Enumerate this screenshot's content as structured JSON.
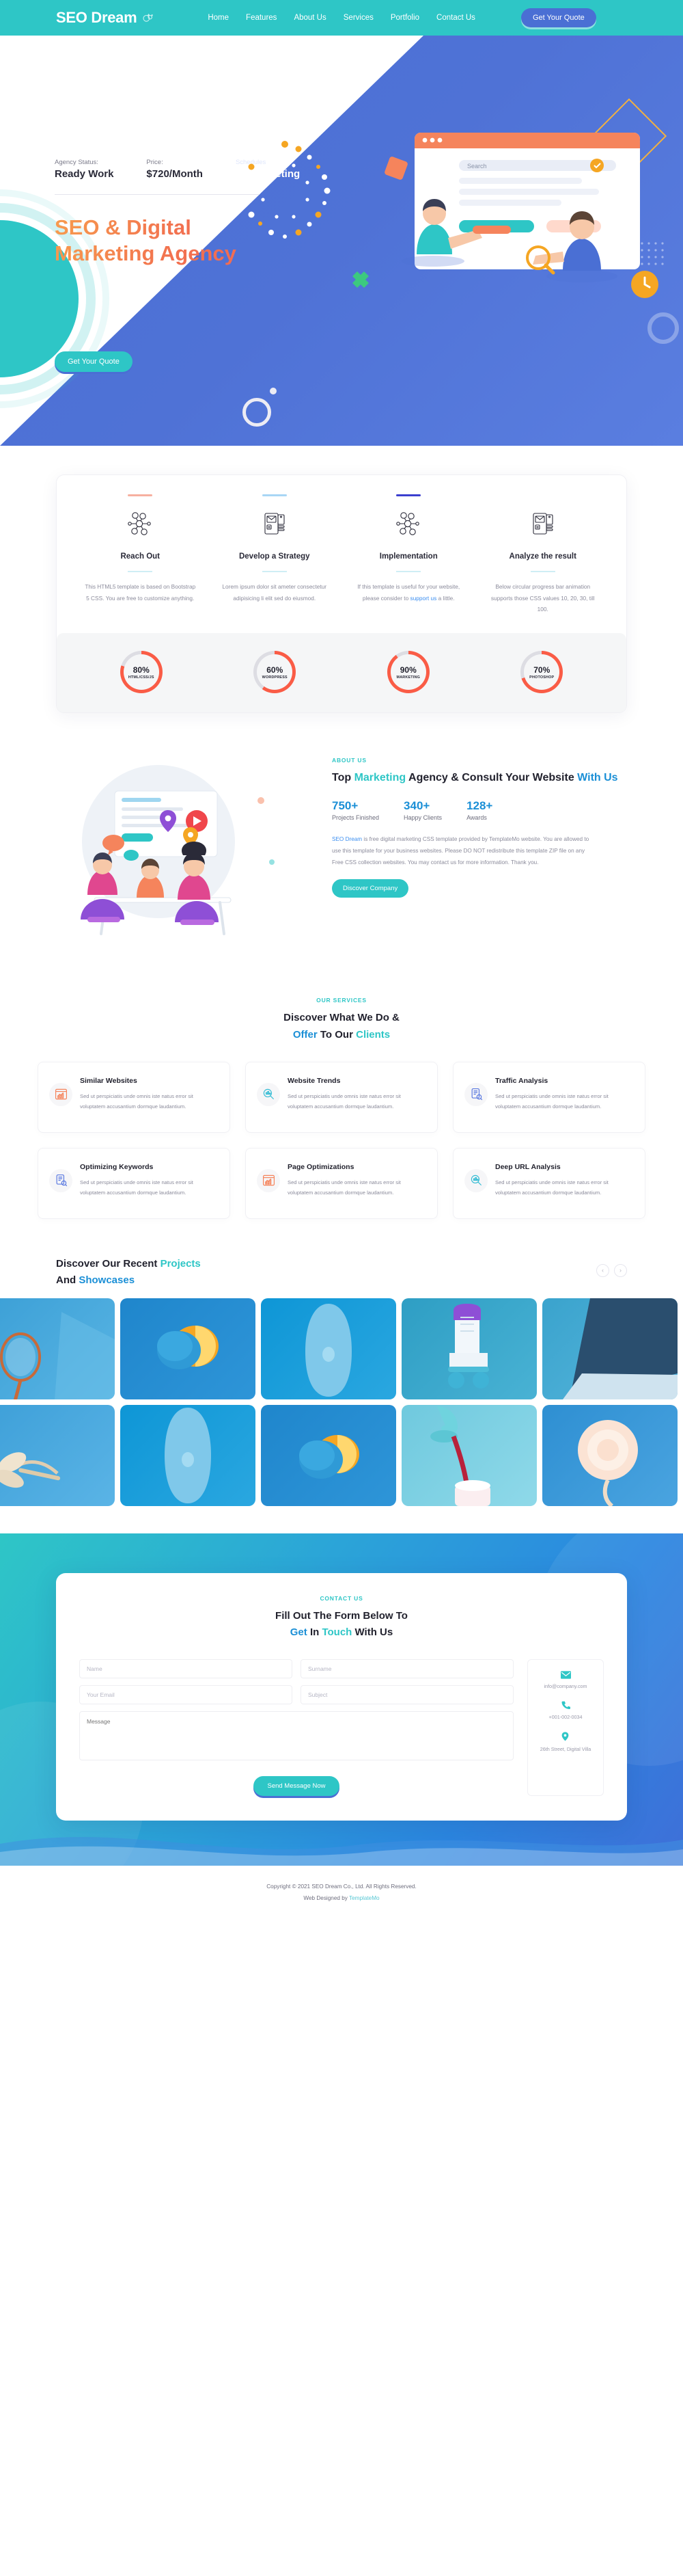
{
  "brand": {
    "name": "SEO Dream",
    "icon": "sparkle-bubbles-icon"
  },
  "nav": {
    "links": [
      {
        "label": "Home"
      },
      {
        "label": "Features"
      },
      {
        "label": "About Us"
      },
      {
        "label": "Services"
      },
      {
        "label": "Portfolio"
      },
      {
        "label": "Contact Us"
      }
    ],
    "cta": "Get Your Quote"
  },
  "hero": {
    "stats": [
      {
        "label": "Agency Status:",
        "value": "Ready Work"
      },
      {
        "label": "Price:",
        "value": "$720/Month"
      },
      {
        "label": "Schedules",
        "value": "$450/Meeting"
      }
    ],
    "title": "SEO & Digital Marketing Agency",
    "cta": "Get Your Quote"
  },
  "process": {
    "items": [
      {
        "top_color": "#f7b0a0",
        "icon": "network-people-icon",
        "title": "Reach Out",
        "text": "This HTML5 template is based on Bootstrap 5 CSS. You are free to customize anything."
      },
      {
        "top_color": "#a8d6f5",
        "icon": "mail-dashboard-icon",
        "title": "Develop a Strategy",
        "text": "Lorem ipsum dolor sit ameter consectetur adipisicing li elit sed do eiusmod."
      },
      {
        "top_color": "#3b3fcf",
        "icon": "network-people-icon",
        "title": "Implementation",
        "text_before": "If this template is useful for your website, please consider to ",
        "link": "support us",
        "text_after": " a little."
      },
      {
        "top_color": "#ffffff",
        "icon": "mail-dashboard-icon",
        "title": "Analyze the result",
        "text": "Below circular progress bar animation supports those CSS values 10, 20, 30, till 100."
      }
    ],
    "skills": [
      {
        "percent": "80%",
        "value": 80,
        "label": "HTML/CSS/JS"
      },
      {
        "percent": "60%",
        "value": 60,
        "label": "WORDPRESS"
      },
      {
        "percent": "90%",
        "value": 90,
        "label": "MARKETING"
      },
      {
        "percent": "70%",
        "value": 70,
        "label": "PHOTOSHOP"
      }
    ],
    "skill_color": "#fa5c46",
    "skill_track": "#dddde3"
  },
  "about": {
    "eyebrow": "ABOUT US",
    "heading_1": "Top ",
    "heading_2": "Marketing",
    "heading_3": " Agency & Consult Your Website ",
    "heading_4": "With Us",
    "counters": [
      {
        "number": "750+",
        "label": "Projects Finished"
      },
      {
        "number": "340+",
        "label": "Happy Clients"
      },
      {
        "number": "128+",
        "label": "Awards"
      }
    ],
    "link_text": "SEO Dream",
    "paragraph": " is free digital marketing CSS template provided by TemplateMo website. You are allowed to use this template for your business websites. Please DO NOT redistribute this template ZIP file on any Free CSS collection websites. You may contact us for more information. Thank you.",
    "button": "Discover Company"
  },
  "services": {
    "eyebrow": "OUR SERVICES",
    "heading_1": "Discover What We Do &",
    "heading_2": "Offer",
    "heading_3": " To Our ",
    "heading_4": "Clients",
    "cards": [
      {
        "icon": "chart-window-icon",
        "icon_color": "#f5845c",
        "title": "Similar Websites",
        "text": "Sed ut perspiciatis unde omnis iste natus error sit voluptatem accusantium dormque laudantium."
      },
      {
        "icon": "magnifier-chart-icon",
        "icon_color": "#35bcd4",
        "title": "Website Trends",
        "text": "Sed ut perspiciatis unde omnis iste natus error sit voluptatem accusantium dormque laudantium."
      },
      {
        "icon": "document-search-icon",
        "icon_color": "#5a79e0",
        "title": "Traffic Analysis",
        "text": "Sed ut perspiciatis unde omnis iste natus error sit voluptatem accusantium dormque laudantium."
      },
      {
        "icon": "document-search-icon",
        "icon_color": "#5a79e0",
        "title": "Optimizing Keywords",
        "text": "Sed ut perspiciatis unde omnis iste natus error sit voluptatem accusantium dormque laudantium."
      },
      {
        "icon": "chart-window-icon",
        "icon_color": "#f5845c",
        "title": "Page Optimizations",
        "text": "Sed ut perspiciatis unde omnis iste natus error sit voluptatem accusantium dormque laudantium."
      },
      {
        "icon": "magnifier-chart-icon",
        "icon_color": "#35bcd4",
        "title": "Deep URL Analysis",
        "text": "Sed ut perspiciatis unde omnis iste natus error sit voluptatem accusantium dormque laudantium."
      }
    ]
  },
  "projects": {
    "heading_1": "Discover Our Recent ",
    "heading_2": "Projects",
    "heading_3": "And ",
    "heading_4": "Showcases",
    "prev_icon": "chevron-left-icon",
    "next_icon": "chevron-right-icon",
    "row1": [
      {
        "name": "tennis-racket",
        "bg": "#3b9fd6",
        "bg2": "#59b5e4"
      },
      {
        "name": "blue-orange",
        "bg": "#1f86cc",
        "bg2": "#2e95d8"
      },
      {
        "name": "skateboard",
        "bg": "#0e96d6",
        "bg2": "#2aa7e0"
      },
      {
        "name": "roller-skate",
        "bg": "#2e9ec4",
        "bg2": "#49b2d4"
      },
      {
        "name": "laptop",
        "bg": "#3aa3cd",
        "bg2": "#57b6dc"
      }
    ],
    "row2": [
      {
        "name": "dragonfly",
        "bg": "#3d9fd8",
        "bg2": "#5ab4e6"
      },
      {
        "name": "skateboard-2",
        "bg": "#0e96d6",
        "bg2": "#2aa7e0"
      },
      {
        "name": "blue-orange-2",
        "bg": "#1f86cc",
        "bg2": "#2e95d8"
      },
      {
        "name": "pouring-drink",
        "bg": "#6fc9de",
        "bg2": "#8fd9e9"
      },
      {
        "name": "flower",
        "bg": "#2e8fd2",
        "bg2": "#4aa4e0"
      }
    ]
  },
  "contact": {
    "eyebrow": "CONTACT US",
    "heading_1": "Fill Out The Form Below To",
    "heading_2": "Get",
    "heading_3": " In ",
    "heading_4": "Touch",
    "heading_5": " With Us",
    "fields": {
      "name": {
        "placeholder": "Name",
        "value": ""
      },
      "surname": {
        "placeholder": "Surname",
        "value": ""
      },
      "email": {
        "placeholder": "Your Email",
        "value": ""
      },
      "subject": {
        "placeholder": "Subject",
        "value": ""
      },
      "message": {
        "placeholder": "Message",
        "value": ""
      }
    },
    "submit": "Send Message Now",
    "info": [
      {
        "icon": "envelope-icon",
        "text": "info@company.com"
      },
      {
        "icon": "phone-icon",
        "text": "+001-002-0034"
      },
      {
        "icon": "map-pin-icon",
        "text": "26th Street, Digital Villa"
      }
    ]
  },
  "footer": {
    "copyright": "Copyright © 2021 SEO Dream Co., Ltd. All Rights Reserved.",
    "designed_by_prefix": "Web Designed by ",
    "designed_by_link": "TemplateMo"
  },
  "colors": {
    "teal": "#2ec6c6",
    "blue": "#4a6fd4",
    "orange": "#f5845c",
    "red": "#fa5c46",
    "link_blue": "#3b8ef0"
  }
}
